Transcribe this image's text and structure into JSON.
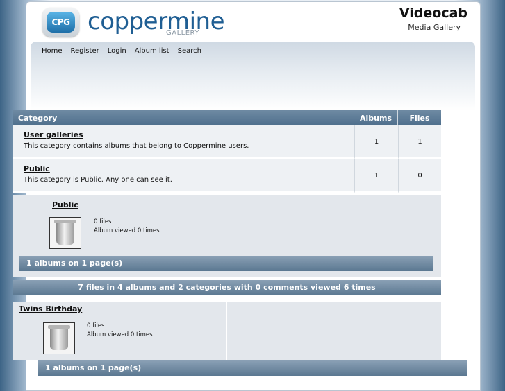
{
  "header": {
    "logo_badge": "CPG",
    "logo_text": "coppermine",
    "logo_sub": "GALLERY",
    "site_title": "Videocab",
    "site_desc": "Media Gallery"
  },
  "nav": [
    "Home",
    "Register",
    "Login",
    "Album list",
    "Search"
  ],
  "category_table": {
    "headers": {
      "category": "Category",
      "albums": "Albums",
      "files": "Files"
    },
    "rows": [
      {
        "name": "User galleries",
        "desc": "This category contains albums that belong to Coppermine users.",
        "albums": "1",
        "files": "1"
      },
      {
        "name": "Public",
        "desc": "This category is Public. Any one can see it.",
        "albums": "1",
        "files": "0"
      }
    ]
  },
  "album_section_1": {
    "album_name": "Public",
    "files": "0 files",
    "views": "Album viewed 0 times",
    "footer": "1 albums on 1 page(s)"
  },
  "stats": "7 files in 4 albums and 2 categories with 0 comments viewed 6 times",
  "album_section_2": {
    "album_name": "Twins Birthday",
    "files": "0 files",
    "views": "Album viewed 0 times",
    "footer": "1 albums on 1 page(s)"
  },
  "icons": {
    "album_thumb": "trash-can-icon"
  }
}
